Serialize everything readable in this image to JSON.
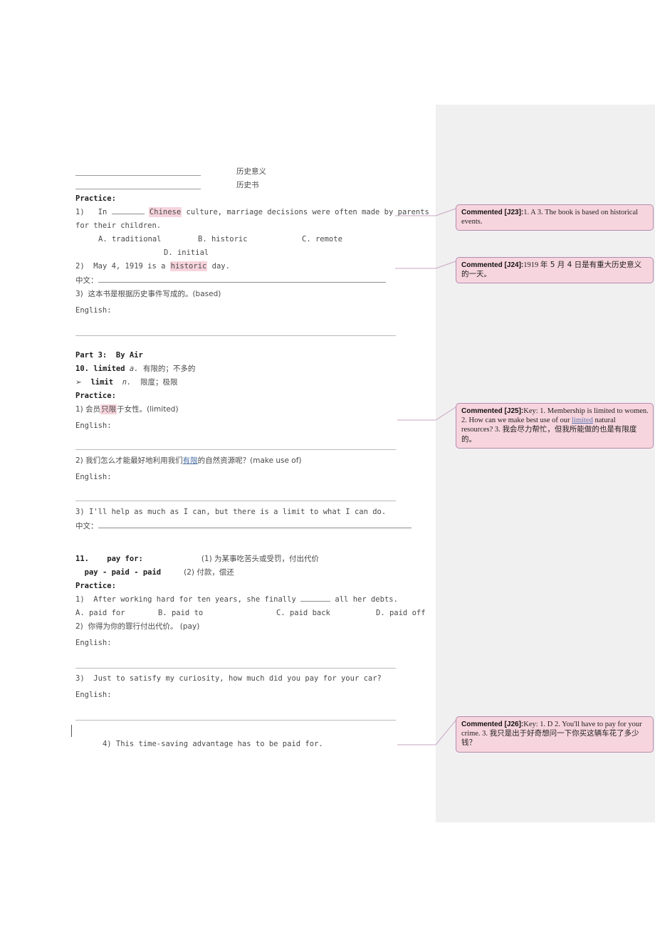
{
  "document": {
    "header_terms": [
      {
        "blank": true,
        "gloss": "历史意义"
      },
      {
        "blank": true,
        "gloss": "历史书"
      }
    ],
    "sections": [
      {
        "practice_label": "Practice:",
        "items": [
          {
            "num": "1)",
            "pre": "   In ",
            "blank": true,
            "highlight": "Chinese",
            "post": " culture, marriage decisions were often made by parents",
            "cont": "for their children.",
            "options": [
              "A. traditional",
              "B. historic",
              "C. remote",
              "D. initial"
            ]
          },
          {
            "num": "2)",
            "pre": "  May 4, 1919 is a ",
            "highlight": "historic",
            "post": " day.",
            "answer_label": "中文："
          },
          {
            "num": "3)",
            "text": "  这本书是根据历史事件写成的。(based)",
            "answer_label": "English:"
          }
        ]
      }
    ],
    "part3": {
      "title": "Part 3:  By Air",
      "entry_num": "10.",
      "entry_word": "limited",
      "entry_pos": "a.",
      "entry_gloss": "有限的；不多的",
      "sub_marker": "➢",
      "sub_word": "limit",
      "sub_pos": "n.",
      "sub_gloss": "限度；极限",
      "practice_label": "Practice:",
      "items": [
        {
          "num": "1)",
          "pre": " 会员",
          "highlight": "只限",
          "post": "于女性。(limited)",
          "answer_label": "English:"
        },
        {
          "num": "2)",
          "pre": " 我们怎么才能最好地利用我们",
          "link": "有限",
          "post": "的自然资源呢？(make use of)",
          "answer_label": "English:"
        },
        {
          "num": "3)",
          "text": " I'll help as much as I can, but there is a limit to what I can do.",
          "answer_label": "中文："
        }
      ]
    },
    "part11": {
      "entry_num": "11.",
      "entry_word": "pay for:",
      "sense1": "(1) 为某事吃苦头或受罚，付出代价",
      "entry_forms": "pay - paid - paid",
      "sense2": "(2) 付款，偿还",
      "practice_label": "Practice:",
      "items": [
        {
          "num": "1)",
          "pre": "  After working hard for ten years, she finally ",
          "blank": true,
          "post": " all her debts.",
          "options": [
            "A. paid for",
            "B. paid to",
            "C. paid back",
            "D. paid off"
          ]
        },
        {
          "num": "2)",
          "text": "  你得为你的罪行付出代价。 (pay)",
          "answer_label": "English:"
        },
        {
          "num": "3)",
          "text": "  Just to satisfy my curiosity, how much did you pay for your car?",
          "answer_label": "English:"
        },
        {
          "num": "4)",
          "text": " This time-saving advantage has to be paid for.",
          "changed": true
        }
      ]
    }
  },
  "comments": [
    {
      "id": "J23",
      "tag": "Commented [J23]:",
      "body": "1. A        3. The book is based on historical events."
    },
    {
      "id": "J24",
      "tag": "Commented [J24]:",
      "body_pre": "1919 ",
      "body_cn": "年 5 月 4 日是有重大历史意义的一天。"
    },
    {
      "id": "J25",
      "tag": "Commented [J25]:",
      "body_pre": "Key: 1. Membership is limited to women.      2. How can we make best use of our ",
      "body_link": "limited",
      "body_mid": " natural resources?   3. ",
      "body_cn": "我会尽力帮忙，但我所能做的也是有限度的。"
    },
    {
      "id": "J26",
      "tag": "Commented [J26]:",
      "body_pre": "Key: 1. D      2. You'll have to pay for your crime.   3. ",
      "body_cn": "我只是出于好奇想问一下你买这辆车花了多少钱？"
    }
  ],
  "colors": {
    "highlight_pink": "#f7d4dc",
    "comment_fill": "#f7d5de",
    "comment_border": "#b48ab0",
    "gutter_grey": "#f0f0f0",
    "hyperlink_blue": "#4a6fa5"
  }
}
